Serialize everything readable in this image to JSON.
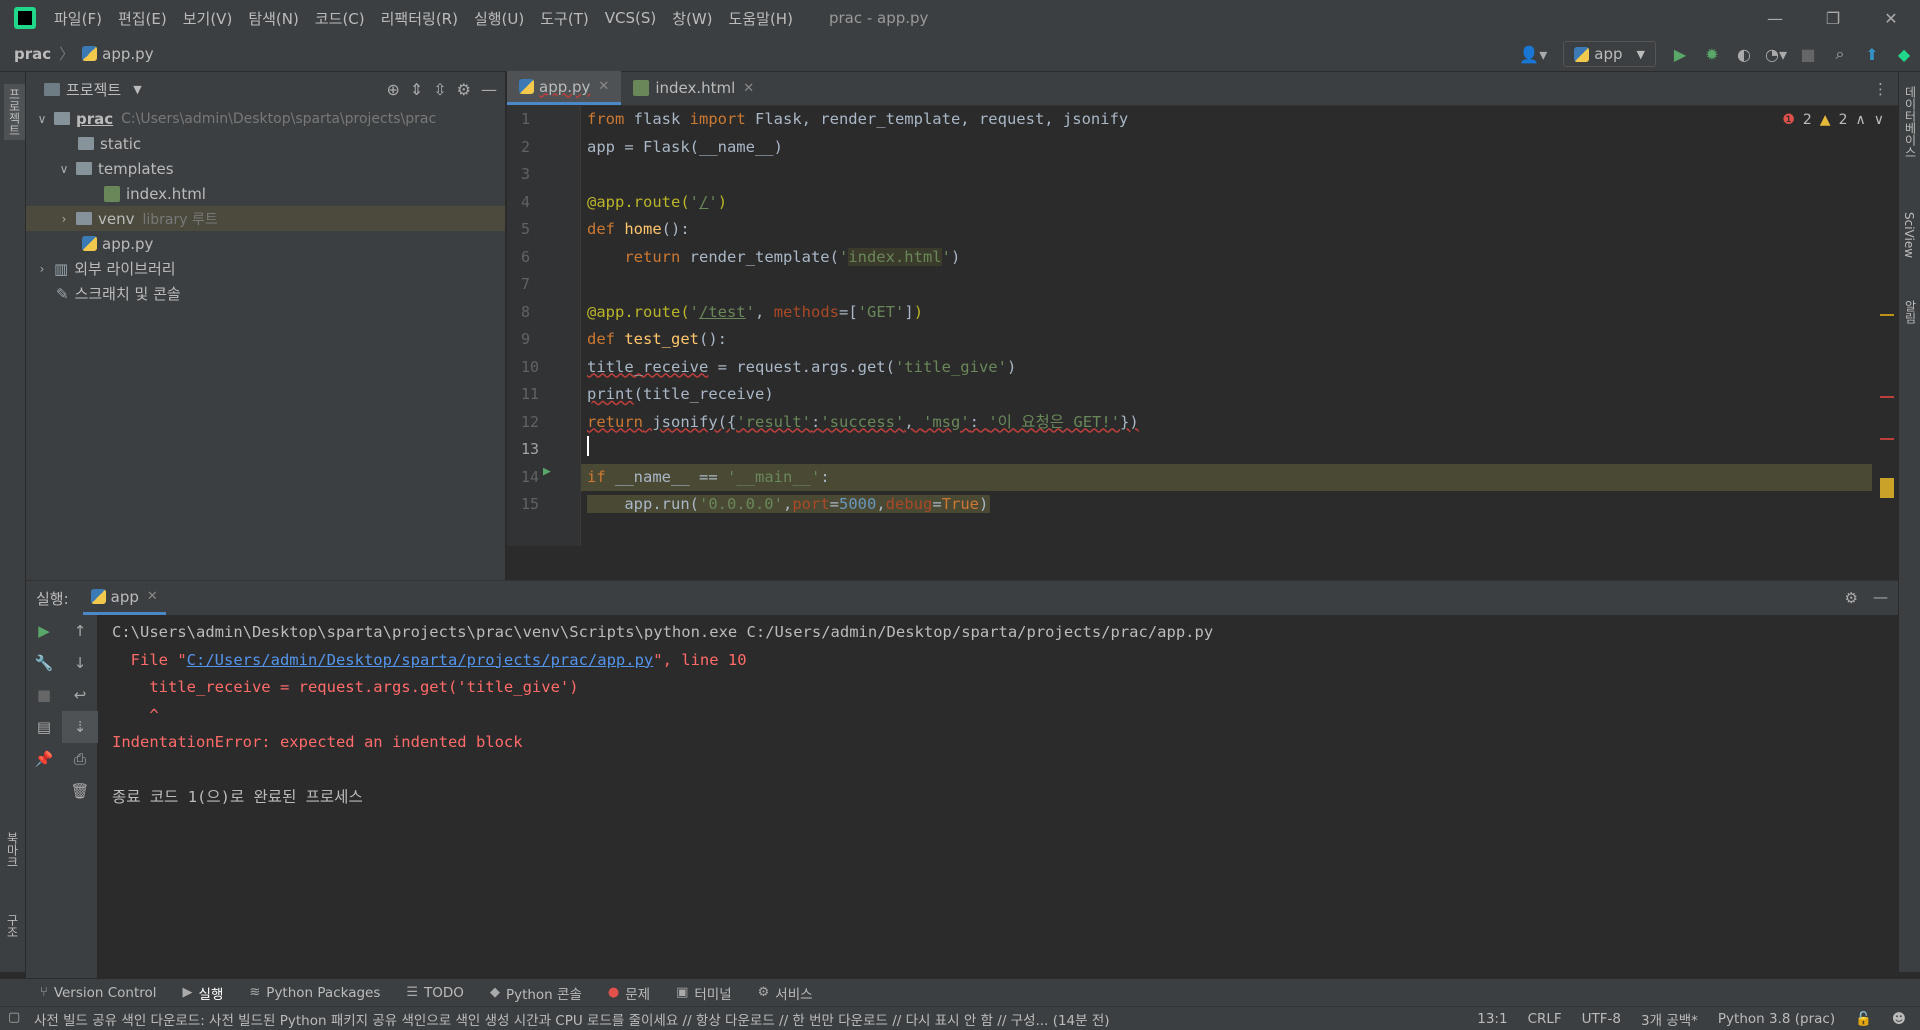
{
  "window": {
    "menu": [
      "파일(F)",
      "편집(E)",
      "보기(V)",
      "탐색(N)",
      "코드(C)",
      "리팩터링(R)",
      "실행(U)",
      "도구(T)",
      "VCS(S)",
      "창(W)",
      "도움말(H)"
    ],
    "title": "prac - app.py"
  },
  "navbar": {
    "project": "prac",
    "file": "app.py",
    "run_config": "app"
  },
  "left_strip": {
    "project_label": "프로젝트",
    "bookmarks_label": "북마크",
    "structure_label": "구조"
  },
  "right_strip": {
    "database_label": "데이터베이스",
    "sciview_label": "SciView",
    "notifications_label": "알림"
  },
  "project_panel": {
    "title": "프로젝트",
    "root_name": "prac",
    "root_path": "C:\\Users\\admin\\Desktop\\sparta\\projects\\prac",
    "static": "static",
    "templates": "templates",
    "index_html": "index.html",
    "venv": "venv",
    "venv_note": "library 루트",
    "app_py": "app.py",
    "external_libs": "외부 라이브러리",
    "scratches": "스크래치 및 콘솔"
  },
  "editor": {
    "tabs": [
      "app.py",
      "index.html"
    ],
    "errors": "2",
    "warnings": "2",
    "line_numbers": [
      "1",
      "2",
      "3",
      "4",
      "5",
      "6",
      "7",
      "8",
      "9",
      "10",
      "11",
      "12",
      "13",
      "14",
      "15"
    ]
  },
  "run_panel": {
    "label": "실행:",
    "tab": "app",
    "console": {
      "cmd": "C:\\Users\\admin\\Desktop\\sparta\\projects\\prac\\venv\\Scripts\\python.exe C:/Users/admin/Desktop/sparta/projects/prac/app.py",
      "file_prefix": "  File \"",
      "file_link": "C:/Users/admin/Desktop/sparta/projects/prac/app.py",
      "file_suffix": "\", line 10",
      "code_line": "    title_receive = request.args.get('title_give')",
      "caret": "    ^",
      "error": "IndentationError: expected an indented block",
      "exit": "종료 코드 1(으)로 완료된 프로세스"
    }
  },
  "bottom_tools": [
    "Version Control",
    "실행",
    "Python Packages",
    "TODO",
    "Python 콘솔",
    "문제",
    "터미널",
    "서비스"
  ],
  "statusbar": {
    "message": "사전 빌드 공유 색인 다운로드: 사전 빌드된 Python 패키지 공유 색인으로 색인 생성 시간과 CPU 로드를 줄이세요 // 항상 다운로드 // 한 번만 다운로드 // 다시 표시 안 함 // 구성... (14분 전)",
    "position": "13:1",
    "line_sep": "CRLF",
    "encoding": "UTF-8",
    "indent": "3개 공백*",
    "interpreter": "Python 3.8 (prac)"
  }
}
